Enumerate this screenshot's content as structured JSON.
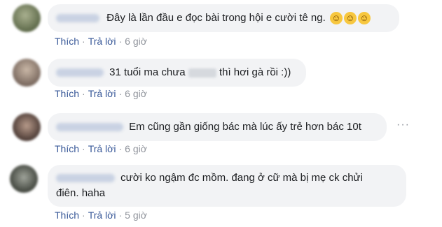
{
  "comments": [
    {
      "text": "Đây là lần đầu e đọc bài trong hội e cười tê ng.",
      "emoji_icons": [
        "grinning-sweat-emoji",
        "grinning-sweat-emoji",
        "grinning-sweat-emoji"
      ],
      "like_label": "Thích",
      "reply_label": "Trả lời",
      "time": "6 giờ"
    },
    {
      "text_before": "31 tuổi ma chưa",
      "text_after": "thì hơi gà rồi :))",
      "like_label": "Thích",
      "reply_label": "Trả lời",
      "time": "6 giờ"
    },
    {
      "text": "Em cũng gần giống bác mà lúc ấy trẻ hơn bác 10t",
      "like_label": "Thích",
      "reply_label": "Trả lời",
      "time": "6 giờ",
      "more_icon": "more-options-icon"
    },
    {
      "text_line1": "cười ko ngậm đc mồm. đang ở cữ mà bị mẹ ck chửi",
      "text_line2": "điên. haha",
      "like_label": "Thích",
      "reply_label": "Trả lời",
      "time": "5 giờ"
    }
  ],
  "separator": "·",
  "colors": {
    "bubble": "#f2f3f5",
    "link": "#385898",
    "meta": "#90949c",
    "text": "#1c1e21"
  }
}
